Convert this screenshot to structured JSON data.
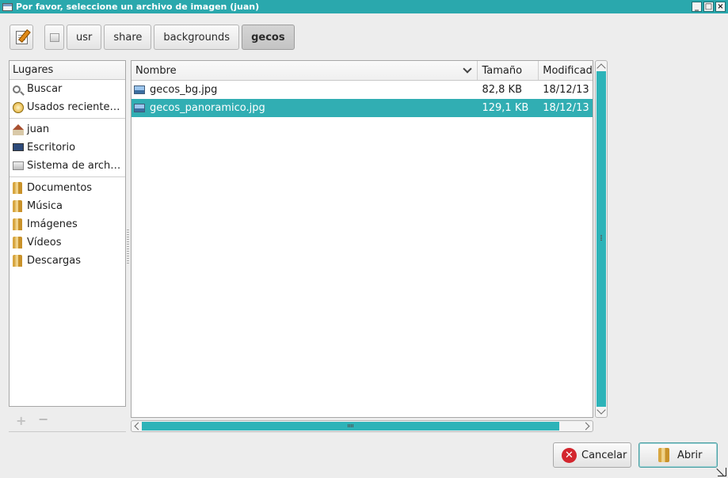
{
  "window": {
    "title": "Por favor, seleccione un archivo de imagen (juan)",
    "buttons": [
      "minimize",
      "maximize",
      "close"
    ]
  },
  "pathbar": {
    "segments": [
      {
        "label": "",
        "icon": "drive-icon"
      },
      {
        "label": "usr"
      },
      {
        "label": "share"
      },
      {
        "label": "backgrounds"
      },
      {
        "label": "gecos",
        "active": true
      }
    ]
  },
  "places": {
    "header": "Lugares",
    "items": [
      {
        "label": "Buscar",
        "icon": "search-icon"
      },
      {
        "label": "Usados reciente…",
        "icon": "recent-icon"
      },
      {
        "label": "juan",
        "icon": "home-icon"
      },
      {
        "label": "Escritorio",
        "icon": "desktop-icon"
      },
      {
        "label": "Sistema de arch…",
        "icon": "filesystem-icon"
      },
      {
        "label": "Documentos",
        "icon": "folder-icon"
      },
      {
        "label": "Música",
        "icon": "folder-icon"
      },
      {
        "label": "Imágenes",
        "icon": "folder-icon"
      },
      {
        "label": "Vídeos",
        "icon": "folder-icon"
      },
      {
        "label": "Descargas",
        "icon": "folder-icon"
      }
    ],
    "add_symbol": "+",
    "remove_symbol": "−"
  },
  "files": {
    "columns": {
      "name": "Nombre",
      "size": "Tamaño",
      "modified": "Modificad"
    },
    "rows": [
      {
        "name": "gecos_bg.jpg",
        "size": "82,8 KB",
        "modified": "18/12/13",
        "selected": false
      },
      {
        "name": "gecos_panoramico.jpg",
        "size": "129,1 KB",
        "modified": "18/12/13",
        "selected": true
      }
    ]
  },
  "actions": {
    "cancel_label": "Cancelar",
    "open_label": "Abrir"
  },
  "colors": {
    "accent": "#2aa8ad",
    "selection": "#31aeb3",
    "cancel_icon": "#d3262e"
  }
}
